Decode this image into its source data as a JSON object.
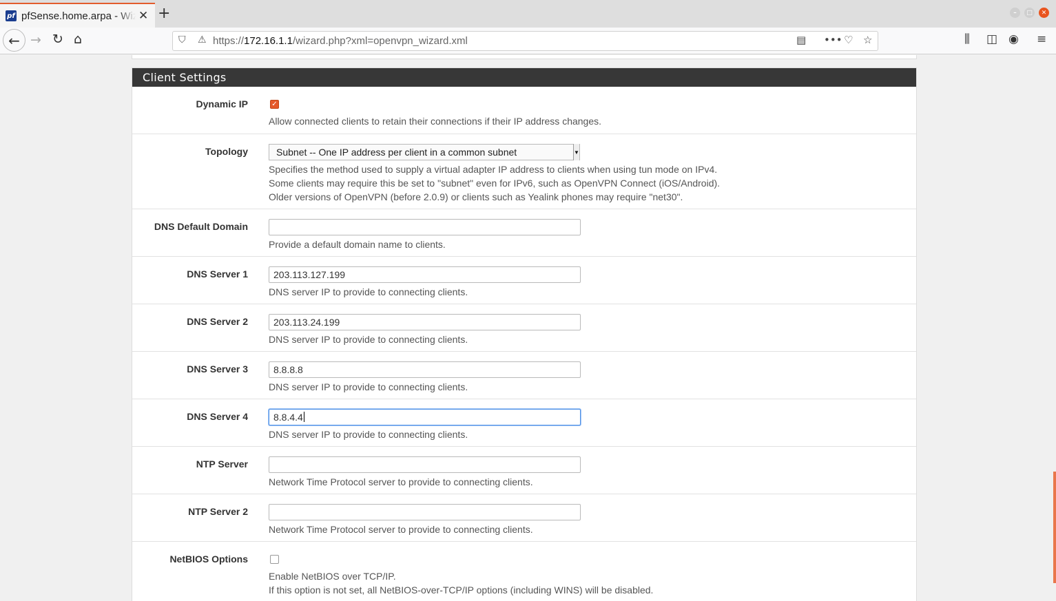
{
  "browser": {
    "tab_title": "pfSense.home.arpa - Wizard",
    "favicon_text": "pf",
    "url_scheme": "https://",
    "url_host": "172.16.1.1",
    "url_path": "/wizard.php?xml=openvpn_wizard.xml"
  },
  "section": {
    "title": "Client Settings"
  },
  "fields": {
    "dynamic_ip": {
      "label": "Dynamic IP",
      "checked": true,
      "help": "Allow connected clients to retain their connections if their IP address changes."
    },
    "topology": {
      "label": "Topology",
      "value": "Subnet -- One IP address per client in a common subnet",
      "help1": "Specifies the method used to supply a virtual adapter IP address to clients when using tun mode on IPv4.",
      "help2": "Some clients may require this be set to \"subnet\" even for IPv6, such as OpenVPN Connect (iOS/Android).",
      "help3": "Older versions of OpenVPN (before 2.0.9) or clients such as Yealink phones may require \"net30\"."
    },
    "dns_domain": {
      "label": "DNS Default Domain",
      "value": "",
      "help": "Provide a default domain name to clients."
    },
    "dns1": {
      "label": "DNS Server 1",
      "value": "203.113.127.199",
      "help": "DNS server IP to provide to connecting clients."
    },
    "dns2": {
      "label": "DNS Server 2",
      "value": "203.113.24.199",
      "help": "DNS server IP to provide to connecting clients."
    },
    "dns3": {
      "label": "DNS Server 3",
      "value": "8.8.8.8",
      "help": "DNS server IP to provide to connecting clients."
    },
    "dns4": {
      "label": "DNS Server 4",
      "value": "8.8.4.4",
      "help": "DNS server IP to provide to connecting clients."
    },
    "ntp1": {
      "label": "NTP Server",
      "value": "",
      "help": "Network Time Protocol server to provide to connecting clients."
    },
    "ntp2": {
      "label": "NTP Server 2",
      "value": "",
      "help": "Network Time Protocol server to provide to connecting clients."
    },
    "netbios": {
      "label": "NetBIOS Options",
      "checked": false,
      "help1": "Enable NetBIOS over TCP/IP.",
      "help2": "If this option is not set, all NetBIOS-over-TCP/IP options (including WINS) will be disabled."
    }
  },
  "colors": {
    "accent": "#e5592a",
    "heading_bg": "#373737",
    "focus": "#4f91e6"
  }
}
